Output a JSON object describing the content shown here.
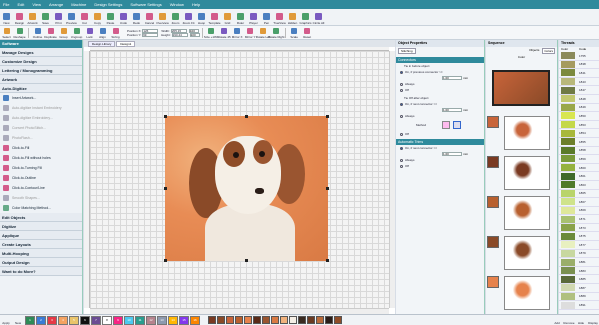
{
  "menu": [
    "File",
    "Edit",
    "View",
    "Arrange",
    "Machine",
    "Design Settings",
    "Software Settings",
    "Window",
    "Help"
  ],
  "ribbon": [
    "New",
    "Design",
    "Artwork",
    "Save",
    "Print",
    "Preview",
    "Cut",
    "Copy",
    "Paste",
    "Undo",
    "Redo",
    "Cancel",
    "Overview",
    "Zoom",
    "Zoom Fit",
    "Hoop",
    "Template",
    "Grid",
    "Ruler",
    "Player",
    "Pen",
    "TrueView",
    "Hidden",
    "Graphics",
    "Circle All"
  ],
  "toolbar2": [
    "Select",
    "Reshape",
    "",
    "Outline",
    "Duplicate",
    "Group",
    "Ungroup",
    "Lock",
    "Align",
    "Sizing",
    "",
    "Size +10%",
    "Rotate 45",
    "Mirror X",
    "Mirror Y",
    "Rotate Left",
    "Rotate Right",
    "",
    "Scale",
    "Reset"
  ],
  "fields": {
    "pos_x_label": "Position X:",
    "pos_x": "126",
    "pos_y_label": "Position Y:",
    "pos_y": "99",
    "width_label": "Width:",
    "width": "205.15",
    "height_label": "Height:",
    "height": "190.44",
    "w_pct": "100",
    "h_pct": "100"
  },
  "left_panel": {
    "title": "Software",
    "sections_top": [
      "Manage Designs",
      "Customize Design",
      "Lettering / Monogramming",
      "Artwork",
      "Auto-Digitize"
    ],
    "items": [
      {
        "label": "Insert Artwork...",
        "disabled": false,
        "color": "#4a7fc0"
      },
      {
        "label": "Auto-digitize Instant Embroidery",
        "disabled": true,
        "color": "#aab"
      },
      {
        "label": "Auto-digitize Embroidery...",
        "disabled": true,
        "color": "#aab"
      },
      {
        "label": "Convert PhotoStitch...",
        "disabled": true,
        "color": "#aab"
      },
      {
        "label": "PhotoFlash...",
        "disabled": true,
        "color": "#aab"
      },
      {
        "label": "Click-to-Fill",
        "disabled": false,
        "color": "#d35b8b"
      },
      {
        "label": "Click-to-Fill without holes",
        "disabled": false,
        "color": "#d35b8b"
      },
      {
        "label": "Click-to-Turning Fill",
        "disabled": false,
        "color": "#d35b8b"
      },
      {
        "label": "Click-to-Outline",
        "disabled": false,
        "color": "#d35b8b"
      },
      {
        "label": "Click-to-Contour/Line",
        "disabled": false,
        "color": "#d35b8b"
      },
      {
        "label": "Smooth Shapes...",
        "disabled": true,
        "color": "#aab"
      },
      {
        "label": "Color Matching Method...",
        "disabled": false,
        "color": "#6a8"
      }
    ],
    "sections_bottom": [
      "Edit Objects",
      "Digitize",
      "Applique",
      "Create Layouts",
      "Multi-Hooping",
      "Output Design",
      "Want to do More?"
    ]
  },
  "doc_tabs": [
    "Design Library",
    "Design1"
  ],
  "object_properties": {
    "title": "Object Properties",
    "tab": "Stitching",
    "connectors_title": "Connectors",
    "tie_in_label": "Tie in before object",
    "tie_in_opts": [
      "On, if previous connector >=",
      "Always",
      "Off"
    ],
    "tie_in_val": "1.00",
    "tie_off_label": "Tie Off after object",
    "tie_off_opts": [
      "On, if next connector >=",
      "Always",
      "Off"
    ],
    "tie_off_val": "1.00",
    "method_label": "Method",
    "auto_trims_title": "Automatic Trims",
    "trim_opts": [
      "On, if next connector >=",
      "Always",
      "Off"
    ],
    "trim_val": "1.00",
    "unit": "mm"
  },
  "sequence": {
    "title": "Sequence",
    "tabs": [
      "Objects",
      "Colors"
    ],
    "color_label": "Color",
    "thumb_colors": [
      "#c8643a",
      "#7a3a22",
      "#b8602f",
      "#8a4a28",
      "#e6824c"
    ]
  },
  "threads": {
    "title": "Threads",
    "headers": [
      "Color",
      "Code"
    ],
    "rows": [
      {
        "color": "#8a8a5a",
        "code": "1755"
      },
      {
        "color": "#a59a5f",
        "code": "1838"
      },
      {
        "color": "#7c8a3e",
        "code": "1841"
      },
      {
        "color": "#b8b87a",
        "code": "1843"
      },
      {
        "color": "#6f7a45",
        "code": "1847"
      },
      {
        "color": "#c2c870",
        "code": "1848"
      },
      {
        "color": "#9aa84a",
        "code": "1849"
      },
      {
        "color": "#d8e650",
        "code": "1850"
      },
      {
        "color": "#c4d84a",
        "code": "1853"
      },
      {
        "color": "#a8b83a",
        "code": "1854"
      },
      {
        "color": "#6c7f2a",
        "code": "1855"
      },
      {
        "color": "#5a7a2a",
        "code": "1858"
      },
      {
        "color": "#7a9a3a",
        "code": "1859"
      },
      {
        "color": "#95b23f",
        "code": "1860"
      },
      {
        "color": "#3f6a2a",
        "code": "1861"
      },
      {
        "color": "#4f7a2a",
        "code": "1863"
      },
      {
        "color": "#b9d46a",
        "code": "1865"
      },
      {
        "color": "#cfe38a",
        "code": "1867"
      },
      {
        "color": "#dfe89a",
        "code": "1869"
      },
      {
        "color": "#a8c070",
        "code": "1871"
      },
      {
        "color": "#8aa24a",
        "code": "1873"
      },
      {
        "color": "#6a8a3a",
        "code": "1875"
      },
      {
        "color": "#e8f0c0",
        "code": "1877"
      },
      {
        "color": "#c8d8a0",
        "code": "1879"
      },
      {
        "color": "#9aae6a",
        "code": "1881"
      },
      {
        "color": "#7a9050",
        "code": "1883"
      },
      {
        "color": "#5a6a3a",
        "code": "1885"
      },
      {
        "color": "#d0d8b0",
        "code": "1887"
      },
      {
        "color": "#b0c080",
        "code": "1889"
      },
      {
        "color": "#dddddd",
        "code": "1891"
      }
    ]
  },
  "bottom": {
    "left_btns": [
      "Apply",
      "New"
    ],
    "colors": [
      "#2e8b57",
      "#3a7bd5",
      "#e63946",
      "#f4a261",
      "#e9c46a",
      "#111111",
      "#6a4c93",
      "#ffffff",
      "#f72585",
      "#4cc9f0",
      "#2a9d8f",
      "#b5838d",
      "#8d99ae",
      "#ffb703",
      "#8338ec",
      "#fb8500"
    ],
    "color_nums": [
      "1",
      "2",
      "3",
      "4",
      "5",
      "6",
      "7",
      "8",
      "9",
      "10",
      "11",
      "12",
      "13",
      "14",
      "15",
      "16"
    ],
    "seq_colors": [
      "#7a3a22",
      "#8a4a28",
      "#c8643a",
      "#b8602f",
      "#e6824c",
      "#5a2a18",
      "#9a5530",
      "#d97a44",
      "#f1b27d",
      "#f5efe6",
      "#3a2a20",
      "#6a3a22",
      "#b86a3a",
      "#2a1d18",
      "#8f4d28"
    ],
    "right_btns": [
      "Add",
      "Remove",
      "Hide",
      "Display"
    ]
  }
}
